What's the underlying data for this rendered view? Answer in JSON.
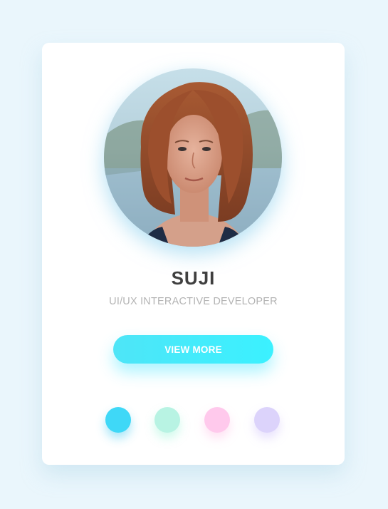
{
  "profile": {
    "name": "SUJI",
    "role": "UI/UX INTERACTIVE DEVELOPER",
    "avatar_alt": "Profile photo"
  },
  "actions": {
    "view_more_label": "VIEW MORE"
  },
  "color_swatches": [
    {
      "name": "cyan",
      "color": "#3fd8f7"
    },
    {
      "name": "mint",
      "color": "#b8f3e3"
    },
    {
      "name": "pink",
      "color": "#ffc9ec"
    },
    {
      "name": "lavender",
      "color": "#dcd3fb"
    }
  ],
  "colors": {
    "background": "#eaf6fc",
    "card": "#ffffff",
    "accent": "#3bf1ff",
    "name_text": "#3f3f3f",
    "role_text": "#b3b3b3"
  }
}
